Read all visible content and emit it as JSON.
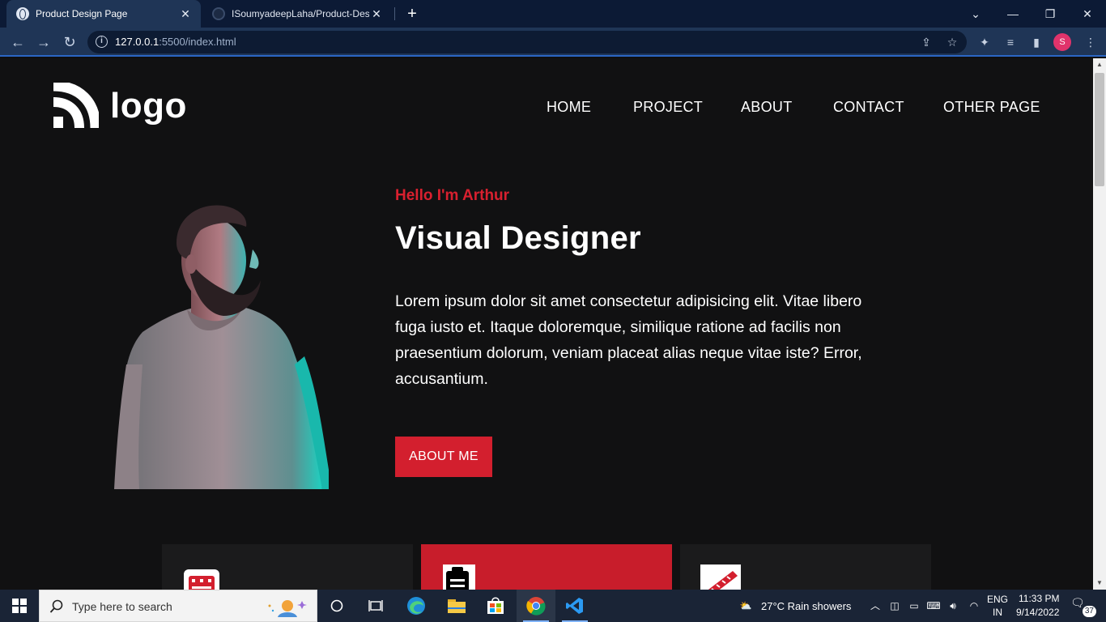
{
  "browser": {
    "tabs": [
      {
        "title": "Product Design Page",
        "active": true,
        "icon": "globe-icon"
      },
      {
        "title": "ISoumyadeepLaha/Product-Desig",
        "active": false,
        "icon": "github-icon"
      }
    ],
    "new_tab_glyph": "+",
    "url_host": "127.0.0.1",
    "url_rest": ":5500/index.html"
  },
  "page": {
    "logo_text": "logo",
    "nav": [
      "HOME",
      "PROJECT",
      "ABOUT",
      "CONTACT",
      "OTHER PAGE"
    ],
    "hero": {
      "greeting": "Hello I'm Arthur",
      "title": "Visual Designer",
      "body": "Lorem ipsum dolor sit amet consectetur adipisicing elit. Vitae libero fuga iusto et. Itaque doloremque, similique ratione ad facilis non praesentium dolorum, veniam placeat alias neque vitae iste? Error, accusantium.",
      "button": "ABOUT ME"
    },
    "cards": [
      {
        "icon": "mixer-icon",
        "bg": "#1b1b1c"
      },
      {
        "icon": "clipboard-icon",
        "bg": "#c81d2b"
      },
      {
        "icon": "ruler-icon",
        "bg": "#1b1b1c"
      }
    ],
    "colors": {
      "accent": "#d31f2e",
      "background": "#111112",
      "text": "#ffffff"
    }
  },
  "taskbar": {
    "search_placeholder": "Type here to search",
    "weather": "27°C  Rain showers",
    "lang_top": "ENG",
    "lang_bottom": "IN",
    "time": "11:33 PM",
    "date": "9/14/2022",
    "notifications": "37"
  }
}
